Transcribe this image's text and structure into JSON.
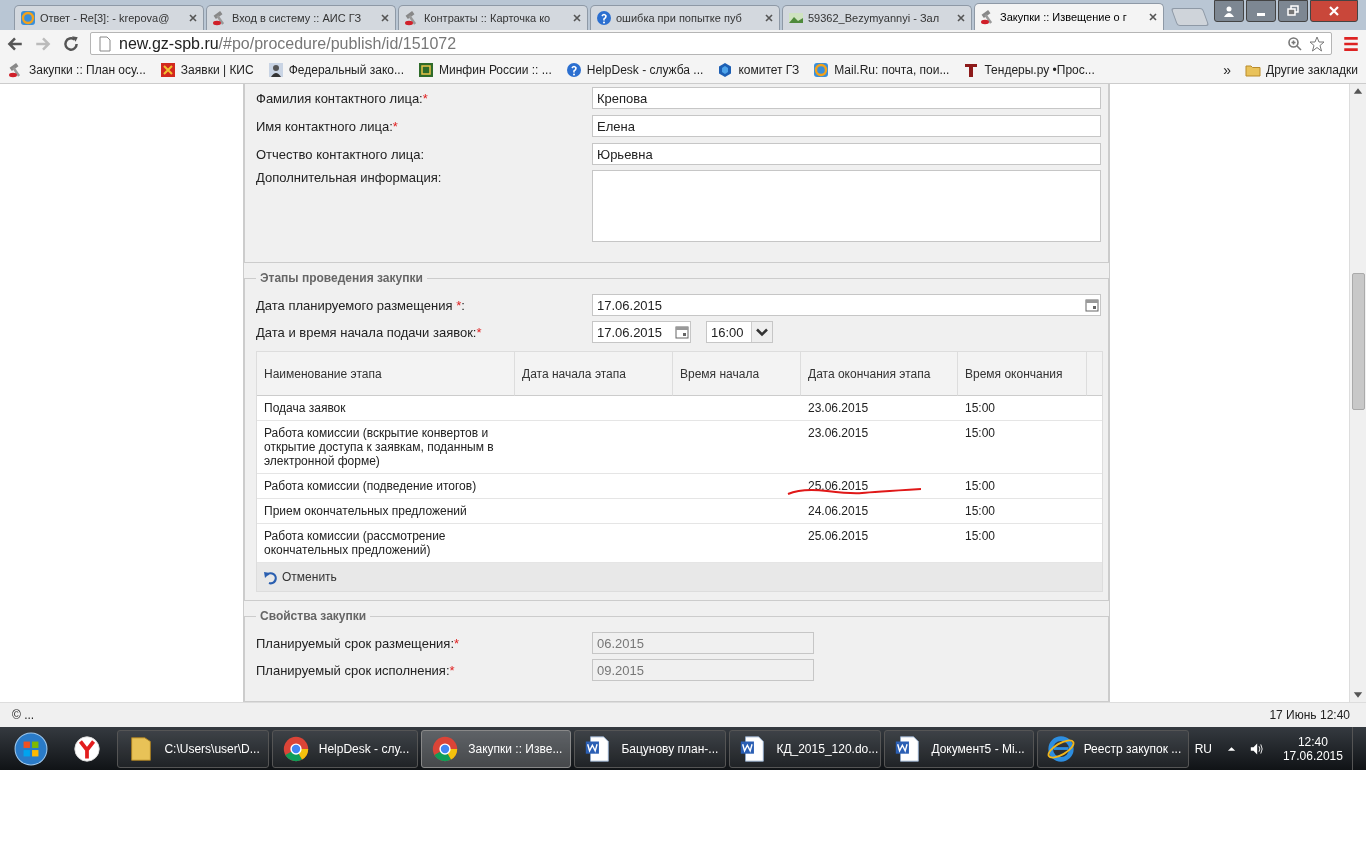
{
  "browser": {
    "tabs": [
      {
        "title": "Ответ - Re[3]: - krepova@",
        "kind": "mail",
        "selected": false
      },
      {
        "title": "Вход в систему :: АИС ГЗ",
        "kind": "hammer",
        "selected": false
      },
      {
        "title": "Контракты :: Карточка ко",
        "kind": "hammer",
        "selected": false
      },
      {
        "title": "ошибка при попытке пуб",
        "kind": "help",
        "selected": false
      },
      {
        "title": "59362_Bezymyannyi - Зал",
        "kind": "image",
        "selected": false
      },
      {
        "title": "Закупки :: Извещение о г",
        "kind": "hammer",
        "selected": true
      }
    ],
    "address": {
      "host": "new.gz-spb.ru",
      "path": "/#po/procedure/publish/id/151072"
    },
    "bookmarks": [
      {
        "label": "Закупки :: План осу...",
        "kind": "hammer"
      },
      {
        "label": "Заявки | КИС",
        "kind": "crest"
      },
      {
        "label": "Федеральный зако...",
        "kind": "person"
      },
      {
        "label": "Минфин России :: ...",
        "kind": "green"
      },
      {
        "label": "HelpDesk - служба ...",
        "kind": "help"
      },
      {
        "label": "комитет ГЗ",
        "kind": "hex"
      },
      {
        "label": "Mail.Ru: почта, пои...",
        "kind": "mail"
      },
      {
        "label": "Тендеры.ру •Прос...",
        "kind": "tender"
      }
    ],
    "more": "»",
    "other_bookmarks": "Другие закладки"
  },
  "contact": {
    "fields": [
      {
        "label": "Фамилия контактного лица:",
        "mark": "*",
        "value": "Крепова"
      },
      {
        "label": "Имя контактного лица:",
        "mark": "*",
        "value": "Елена"
      },
      {
        "label": "Отчество контактного лица:",
        "value": "Юрьевна"
      }
    ],
    "additional_info": {
      "label": "Дополнительная информация:"
    }
  },
  "stages": {
    "legend": "Этапы проведения закупки",
    "planned_date": {
      "label": "Дата планируемого размещения ",
      "mark": "*",
      "suffix": ":",
      "value": "17.06.2015"
    },
    "start": {
      "label": "Дата и время начала подачи заявок:",
      "mark": "*",
      "date": "17.06.2015",
      "time": "16:00"
    },
    "table": {
      "columns": [
        "Наименование этапа",
        "Дата начала этапа",
        "Время начала",
        "Дата окончания этапа",
        "Время окончания"
      ],
      "rows": [
        {
          "name": "Подача заявок",
          "end_date": "23.06.2015",
          "end_time": "15:00",
          "scribbled": false
        },
        {
          "name": "Работа комиссии (вскрытие конвертов и открытие доступа к заявкам, поданным в электронной форме)",
          "end_date": "23.06.2015",
          "end_time": "15:00",
          "scribbled": false
        },
        {
          "name": "Работа комиссии (подведение итогов)",
          "end_date": "25.06.2015",
          "end_time": "15:00",
          "scribbled": true
        },
        {
          "name": "Прием окончательных предложений",
          "end_date": "24.06.2015",
          "end_time": "15:00",
          "scribbled": false
        },
        {
          "name": "Работа комиссии (рассмотрение окончательных предложений)",
          "end_date": "25.06.2015",
          "end_time": "15:00",
          "scribbled": false
        }
      ]
    },
    "cancel": "Отменить"
  },
  "properties": {
    "legend": "Свойства закупки",
    "fields": [
      {
        "label": "Планируемый срок размещения:",
        "mark": "*",
        "value": "06.2015",
        "disabled": true
      },
      {
        "label": "Планируемый срок исполнения:",
        "mark": "*",
        "value": "09.2015",
        "disabled": true
      }
    ]
  },
  "status_bar": {
    "left": "© ...",
    "right": "17 Июнь 12:40"
  },
  "taskbar": {
    "items": [
      {
        "label": "C:\\Users\\user\\D...",
        "kind": "folder",
        "selected": false
      },
      {
        "label": "HelpDesk - слу...",
        "kind": "chrome",
        "selected": false
      },
      {
        "label": "Закупки :: Изве...",
        "kind": "chrome",
        "selected": true
      },
      {
        "label": "Бацунову план-...",
        "kind": "word",
        "selected": false
      },
      {
        "label": "КД_2015_120.do...",
        "kind": "word",
        "selected": false
      },
      {
        "label": "Документ5 - Mi...",
        "kind": "word",
        "selected": false
      },
      {
        "label": "Реестр закупок ...",
        "kind": "ie",
        "selected": false
      }
    ],
    "language": "RU",
    "time": "12:40",
    "date": "17.06.2015"
  }
}
